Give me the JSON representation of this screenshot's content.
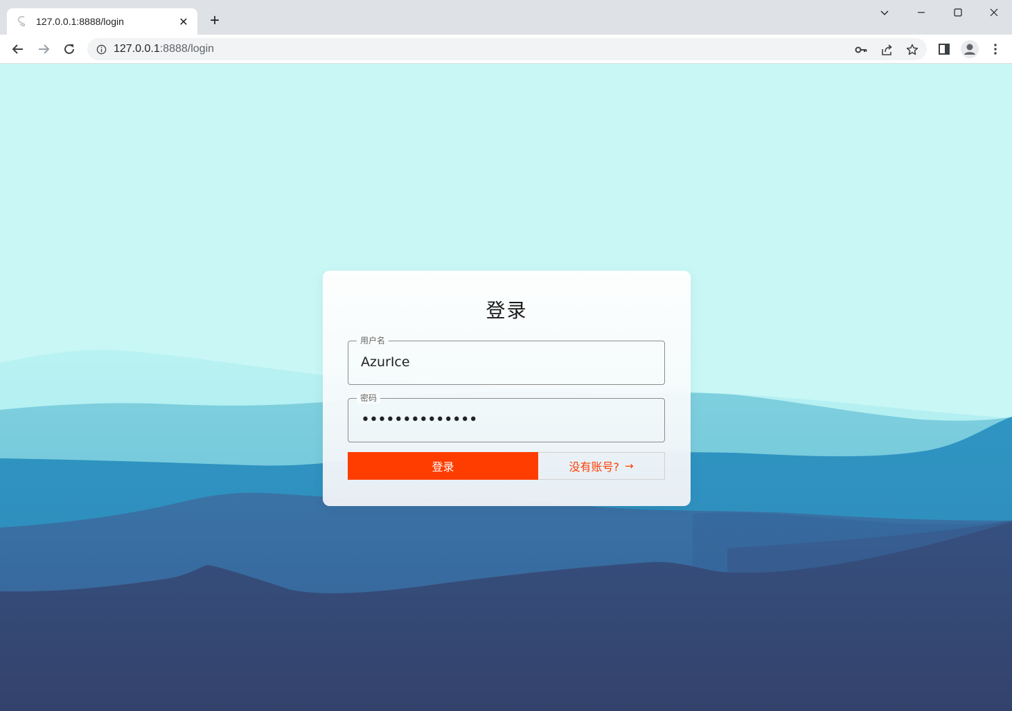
{
  "browser": {
    "tab_title": "127.0.0.1:8888/login",
    "new_tab_symbol": "+",
    "close_symbol": "✕",
    "url_host": "127.0.0.1",
    "url_rest": ":8888/login"
  },
  "login": {
    "title": "登录",
    "username_label": "用户名",
    "username_value": "AzurIce",
    "password_label": "密码",
    "password_masked": "••••••••••••••",
    "login_button": "登录",
    "register_button": "没有账号?",
    "register_arrow": "→"
  },
  "icons": {
    "tab_favicon": "svelte-icon",
    "back": "back-arrow-icon",
    "forward": "forward-arrow-icon",
    "reload": "reload-icon",
    "info": "info-icon",
    "key": "key-icon",
    "share": "share-icon",
    "star": "star-icon",
    "side_panel": "side-panel-icon",
    "profile": "profile-icon",
    "menu": "kebab-menu-icon"
  },
  "colors": {
    "accent": "#ff3d00",
    "sky": "#c9f7f6",
    "mountain_dark": "#33426b"
  }
}
